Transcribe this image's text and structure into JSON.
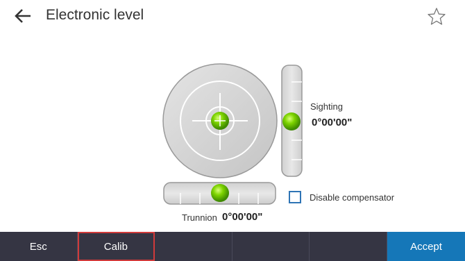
{
  "header": {
    "title": "Electronic level",
    "back_icon": "arrow-left-icon",
    "favorite_icon": "star-outline-icon"
  },
  "level": {
    "sighting_label": "Sighting",
    "sighting_value": "0°00'00\"",
    "trunnion_label": "Trunnion",
    "trunnion_value": "0°00'00\"",
    "bubble_color": "#6cc400"
  },
  "compensator": {
    "label": "Disable compensator",
    "checked": false
  },
  "toolbar": {
    "esc_label": "Esc",
    "calib_label": "Calib",
    "accept_label": "Accept",
    "accent_color": "#1577b8",
    "highlight_color": "#d13a3a"
  }
}
